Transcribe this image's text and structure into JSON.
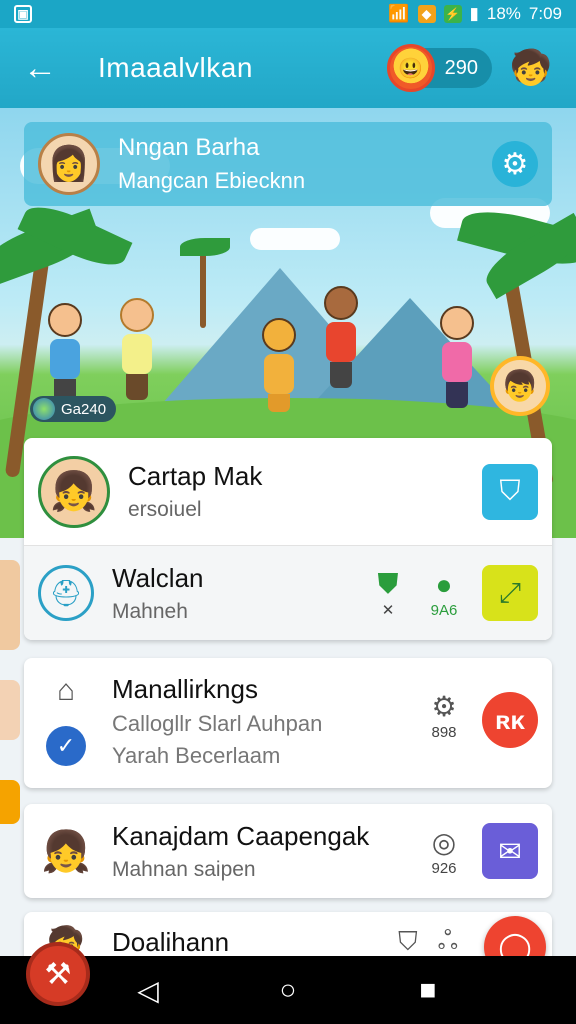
{
  "status_bar": {
    "battery": "18%",
    "time": "7:09"
  },
  "app_bar": {
    "title": "Imaaalvlkan",
    "coins": "290"
  },
  "profile": {
    "name": "Nngan Barha",
    "subtitle": "Mangcan Ebiecknn"
  },
  "hero": {
    "score": "Ga240"
  },
  "cards": [
    {
      "title": "Cartap Mak",
      "subtitle": "ersoiuel"
    },
    {
      "title": "Walclan",
      "subtitle": "Mahneh",
      "stat1": "",
      "stat2": "9A6"
    },
    {
      "title": "Manallirkngs",
      "line2": "Callogllr Slarl Auhpan",
      "line3": "Yarah Becerlaam",
      "stat": "898"
    },
    {
      "title": "Kanajdam Caapengak",
      "subtitle": "Mahnan saipen",
      "stat": "926"
    },
    {
      "title": "Doalihann"
    }
  ],
  "colors": {
    "primary": "#22a7c7",
    "accent_red": "#ee4430",
    "blue_btn": "#2fb6e0",
    "yellow_btn": "#d8e21a",
    "purple_btn": "#6a5ed8"
  },
  "icons": {
    "back": "arrow-left-icon",
    "settings": "gear-icon",
    "shield": "shield-icon",
    "mail": "envelope-icon"
  }
}
